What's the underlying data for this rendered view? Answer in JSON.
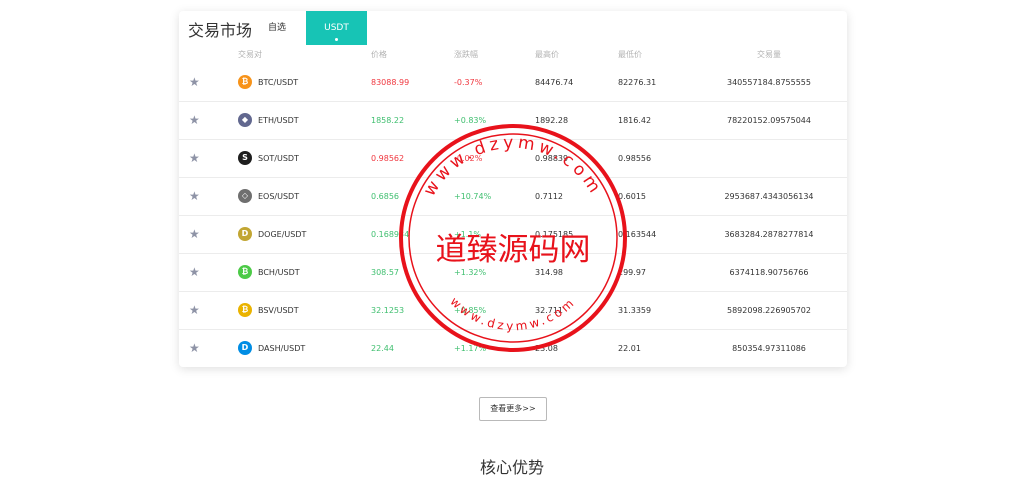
{
  "market": {
    "title": "交易市场",
    "tabs": [
      {
        "label": "自选",
        "active": false
      },
      {
        "label": "USDT",
        "active": true
      }
    ],
    "columns": [
      "交易对",
      "价格",
      "涨跌幅",
      "最高价",
      "最低价",
      "交易量"
    ],
    "rows": [
      {
        "icon": "btc-coin-icon",
        "icon_glyph": "₿",
        "icon_color": "#f7931a",
        "pair": "BTC/USDT",
        "price": "83088.99",
        "change": "-0.37%",
        "trend": "down",
        "high": "84476.74",
        "low": "82276.31",
        "volume": "340557184.8755555"
      },
      {
        "icon": "eth-coin-icon",
        "icon_glyph": "◆",
        "icon_color": "#62688f",
        "pair": "ETH/USDT",
        "price": "1858.22",
        "change": "+0.83%",
        "trend": "up",
        "high": "1892.28",
        "low": "1816.42",
        "volume": "78220152.09575044"
      },
      {
        "icon": "sot-coin-icon",
        "icon_glyph": "S",
        "icon_color": "#1e1e1e",
        "pair": "SOT/USDT",
        "price": "0.98562",
        "change": "-0.02%",
        "trend": "down",
        "high": "0.98839",
        "low": "0.98556",
        "volume": ""
      },
      {
        "icon": "eos-coin-icon",
        "icon_glyph": "◇",
        "icon_color": "#6f6f6f",
        "pair": "EOS/USDT",
        "price": "0.6856",
        "change": "+10.74%",
        "trend": "up",
        "high": "0.7112",
        "low": "0.6015",
        "volume": "2953687.4343056134"
      },
      {
        "icon": "doge-coin-icon",
        "icon_glyph": "D",
        "icon_color": "#c2a633",
        "pair": "DOGE/USDT",
        "price": "0.168934",
        "change": "+1.1%",
        "trend": "up",
        "high": "0.175185",
        "low": "0.163544",
        "volume": "3683284.2878277814"
      },
      {
        "icon": "bch-coin-icon",
        "icon_glyph": "₿",
        "icon_color": "#4cca47",
        "pair": "BCH/USDT",
        "price": "308.57",
        "change": "+1.32%",
        "trend": "up",
        "high": "314.98",
        "low": "299.97",
        "volume": "6374118.90756766"
      },
      {
        "icon": "bsv-coin-icon",
        "icon_glyph": "₿",
        "icon_color": "#eab300",
        "pair": "BSV/USDT",
        "price": "32.1253",
        "change": "+0.85%",
        "trend": "up",
        "high": "32.711",
        "low": "31.3359",
        "volume": "5892098.226905702"
      },
      {
        "icon": "dash-coin-icon",
        "icon_glyph": "D",
        "icon_color": "#008de4",
        "pair": "DASH/USDT",
        "price": "22.44",
        "change": "+1.17%",
        "trend": "up",
        "high": "23.08",
        "low": "22.01",
        "volume": "850354.97311086"
      }
    ],
    "colors": {
      "up": "#3fbf6f",
      "down": "#f0373f",
      "accent": "#17c4b5"
    }
  },
  "more_button": "查看更多>>",
  "section_title": "核心优势",
  "watermark": {
    "text": "道臻源码网",
    "url": "www.dzymw.com",
    "color": "#e8121b"
  }
}
